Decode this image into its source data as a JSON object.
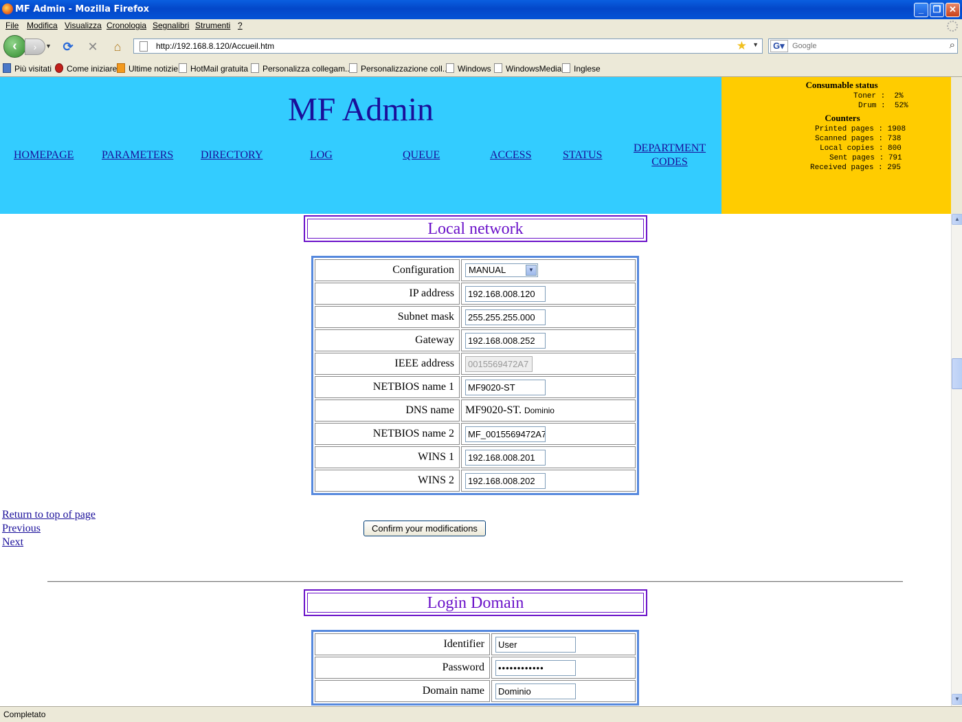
{
  "window": {
    "title": "MF Admin - Mozilla Firefox",
    "controls": [
      "_",
      "❐",
      "✕"
    ]
  },
  "menu": [
    "File",
    "Modifica",
    "Visualizza",
    "Cronologia",
    "Segnalibri",
    "Strumenti",
    "?"
  ],
  "nav": {
    "url": "http://192.168.8.120/Accueil.htm",
    "search_placeholder": "Google"
  },
  "bookmarks": [
    "Più visitati",
    "Come iniziare",
    "Ultime notizie",
    "HotMail gratuita",
    "Personalizza collegam...",
    "Personalizzazione coll...",
    "Windows",
    "WindowsMedia",
    "Inglese"
  ],
  "header": {
    "app_title": "MF Admin",
    "links": [
      "HOMEPAGE",
      "PARAMETERS",
      "DIRECTORY",
      "LOG",
      "QUEUE",
      "ACCESS",
      "STATUS",
      "DEPARTMENT",
      "CODES"
    ]
  },
  "status_panel": {
    "consumable_heading": "Consumable status",
    "consumables": [
      {
        "label": "Toner",
        "value": "2%"
      },
      {
        "label": "Drum",
        "value": "52%"
      }
    ],
    "counters_heading": "Counters",
    "counters": [
      {
        "label": "Printed pages",
        "value": "1908"
      },
      {
        "label": "Scanned pages",
        "value": "738"
      },
      {
        "label": "Local copies",
        "value": "800"
      },
      {
        "label": "Sent pages",
        "value": "791"
      },
      {
        "label": "Received pages",
        "value": "295"
      }
    ]
  },
  "local_network": {
    "title": "Local network",
    "configuration_label": "Configuration",
    "configuration_value": "MANUAL",
    "ip_label": "IP address",
    "ip_value": "192.168.008.120",
    "subnet_label": "Subnet mask",
    "subnet_value": "255.255.255.000",
    "gateway_label": "Gateway",
    "gateway_value": "192.168.008.252",
    "ieee_label": "IEEE address",
    "ieee_value": "0015569472A7",
    "netbios1_label": "NETBIOS name 1",
    "netbios1_value": "MF9020-ST",
    "dns_label": "DNS name",
    "dns_value_prefix": "MF9020-ST.",
    "dns_value_domain": "Dominio",
    "netbios2_label": "NETBIOS name 2",
    "netbios2_value": "MF_0015569472A7",
    "wins1_label": "WINS 1",
    "wins1_value": "192.168.008.201",
    "wins2_label": "WINS 2",
    "wins2_value": "192.168.008.202"
  },
  "page_links": {
    "top": "Return to top of page",
    "previous": "Previous",
    "next": "Next"
  },
  "confirm_button": "Confirm your modifications",
  "login_domain": {
    "title": "Login Domain",
    "identifier_label": "Identifier",
    "identifier_value": "User",
    "password_label": "Password",
    "password_value": "••••••••••••",
    "domain_label": "Domain name",
    "domain_value": "Dominio"
  },
  "statusbar": "Completato"
}
